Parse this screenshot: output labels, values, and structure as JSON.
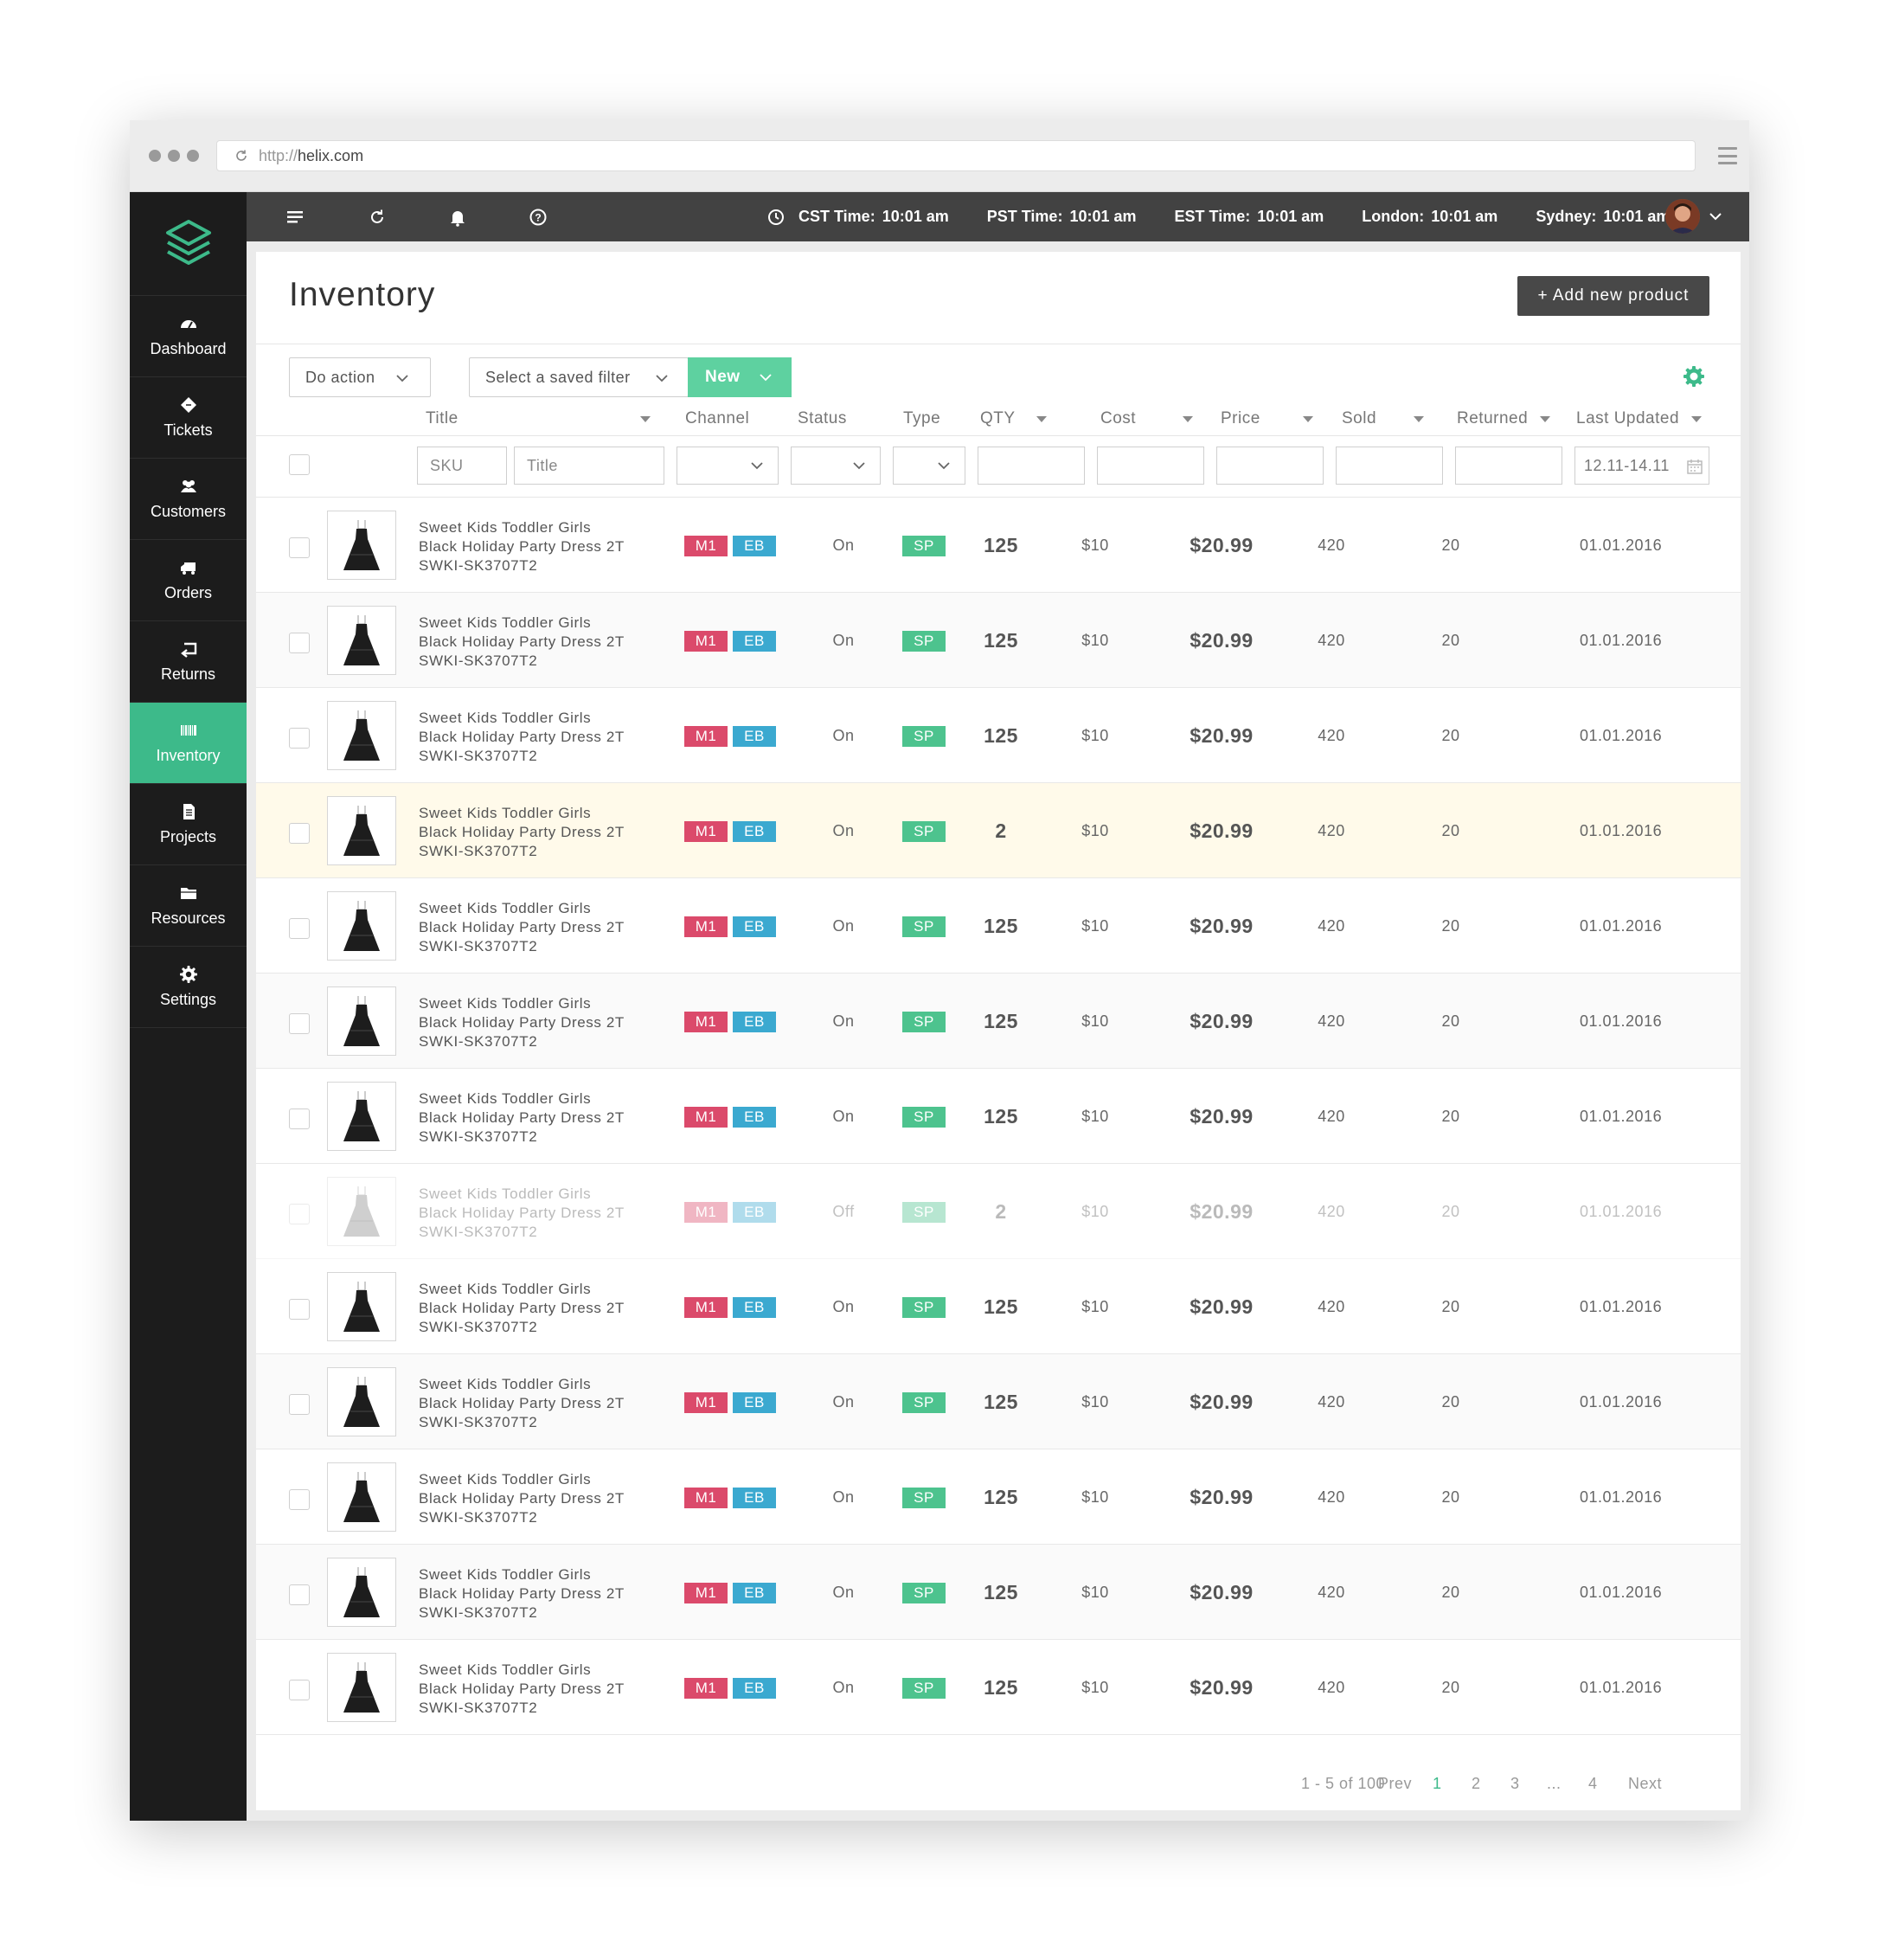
{
  "browser": {
    "url_proto": "http://",
    "url_host": "helix.com"
  },
  "topbar": {
    "times": [
      {
        "label": "CST Time:",
        "value": "10:01 am"
      },
      {
        "label": "PST Time:",
        "value": "10:01 am"
      },
      {
        "label": "EST Time:",
        "value": "10:01 am"
      },
      {
        "label": "London:",
        "value": "10:01 am"
      },
      {
        "label": "Sydney:",
        "value": "10:01 am"
      }
    ]
  },
  "sidebar": {
    "items": [
      {
        "label": "Dashboard",
        "icon": "dashboard-icon"
      },
      {
        "label": "Tickets",
        "icon": "ticket-icon"
      },
      {
        "label": "Customers",
        "icon": "customers-icon"
      },
      {
        "label": "Orders",
        "icon": "truck-icon"
      },
      {
        "label": "Returns",
        "icon": "return-icon"
      },
      {
        "label": "Inventory",
        "icon": "barcode-icon"
      },
      {
        "label": "Projects",
        "icon": "document-icon"
      },
      {
        "label": "Resources",
        "icon": "folder-icon"
      },
      {
        "label": "Settings",
        "icon": "gear-icon"
      }
    ],
    "active": "Inventory"
  },
  "page": {
    "title": "Inventory",
    "add_button": "+ Add new product"
  },
  "toolbar": {
    "do_action": "Do action",
    "saved_filter": "Select a saved filter",
    "new_label": "New"
  },
  "columns": {
    "title": "Title",
    "channel": "Channel",
    "status": "Status",
    "type": "Type",
    "qty": "QTY",
    "cost": "Cost",
    "price": "Price",
    "sold": "Sold",
    "returned": "Returned",
    "last_updated": "Last Updated"
  },
  "filters": {
    "sku_placeholder": "SKU",
    "title_placeholder": "Title",
    "date_range": "12.11-14.11"
  },
  "rows": [
    {
      "title1": "Sweet Kids Toddler Girls",
      "title2": "Black Holiday Party Dress 2T",
      "sku": "SWKI-SK3707T2",
      "ch1": "M1",
      "ch2": "EB",
      "status": "On",
      "type": "SP",
      "qty": "125",
      "cost": "$10",
      "price": "$20.99",
      "sold": "420",
      "returned": "20",
      "updated": "01.01.2016",
      "state": "normal"
    },
    {
      "title1": "Sweet Kids Toddler Girls",
      "title2": "Black Holiday Party Dress 2T",
      "sku": "SWKI-SK3707T2",
      "ch1": "M1",
      "ch2": "EB",
      "status": "On",
      "type": "SP",
      "qty": "125",
      "cost": "$10",
      "price": "$20.99",
      "sold": "420",
      "returned": "20",
      "updated": "01.01.2016",
      "state": "alt"
    },
    {
      "title1": "Sweet Kids Toddler Girls",
      "title2": "Black Holiday Party Dress 2T",
      "sku": "SWKI-SK3707T2",
      "ch1": "M1",
      "ch2": "EB",
      "status": "On",
      "type": "SP",
      "qty": "125",
      "cost": "$10",
      "price": "$20.99",
      "sold": "420",
      "returned": "20",
      "updated": "01.01.2016",
      "state": "normal"
    },
    {
      "title1": "Sweet Kids Toddler Girls",
      "title2": "Black Holiday Party Dress 2T",
      "sku": "SWKI-SK3707T2",
      "ch1": "M1",
      "ch2": "EB",
      "status": "On",
      "type": "SP",
      "qty": "2",
      "cost": "$10",
      "price": "$20.99",
      "sold": "420",
      "returned": "20",
      "updated": "01.01.2016",
      "state": "highlight"
    },
    {
      "title1": "Sweet Kids Toddler Girls",
      "title2": "Black Holiday Party Dress 2T",
      "sku": "SWKI-SK3707T2",
      "ch1": "M1",
      "ch2": "EB",
      "status": "On",
      "type": "SP",
      "qty": "125",
      "cost": "$10",
      "price": "$20.99",
      "sold": "420",
      "returned": "20",
      "updated": "01.01.2016",
      "state": "normal"
    },
    {
      "title1": "Sweet Kids Toddler Girls",
      "title2": "Black Holiday Party Dress 2T",
      "sku": "SWKI-SK3707T2",
      "ch1": "M1",
      "ch2": "EB",
      "status": "On",
      "type": "SP",
      "qty": "125",
      "cost": "$10",
      "price": "$20.99",
      "sold": "420",
      "returned": "20",
      "updated": "01.01.2016",
      "state": "alt"
    },
    {
      "title1": "Sweet Kids Toddler Girls",
      "title2": "Black Holiday Party Dress 2T",
      "sku": "SWKI-SK3707T2",
      "ch1": "M1",
      "ch2": "EB",
      "status": "On",
      "type": "SP",
      "qty": "125",
      "cost": "$10",
      "price": "$20.99",
      "sold": "420",
      "returned": "20",
      "updated": "01.01.2016",
      "state": "normal"
    },
    {
      "title1": "Sweet Kids Toddler Girls",
      "title2": "Black Holiday Party Dress 2T",
      "sku": "SWKI-SK3707T2",
      "ch1": "M1",
      "ch2": "EB",
      "status": "Off",
      "type": "SP",
      "qty": "2",
      "cost": "$10",
      "price": "$20.99",
      "sold": "420",
      "returned": "20",
      "updated": "01.01.2016",
      "state": "off"
    },
    {
      "title1": "Sweet Kids Toddler Girls",
      "title2": "Black Holiday Party Dress 2T",
      "sku": "SWKI-SK3707T2",
      "ch1": "M1",
      "ch2": "EB",
      "status": "On",
      "type": "SP",
      "qty": "125",
      "cost": "$10",
      "price": "$20.99",
      "sold": "420",
      "returned": "20",
      "updated": "01.01.2016",
      "state": "normal"
    },
    {
      "title1": "Sweet Kids Toddler Girls",
      "title2": "Black Holiday Party Dress 2T",
      "sku": "SWKI-SK3707T2",
      "ch1": "M1",
      "ch2": "EB",
      "status": "On",
      "type": "SP",
      "qty": "125",
      "cost": "$10",
      "price": "$20.99",
      "sold": "420",
      "returned": "20",
      "updated": "01.01.2016",
      "state": "alt"
    },
    {
      "title1": "Sweet Kids Toddler Girls",
      "title2": "Black Holiday Party Dress 2T",
      "sku": "SWKI-SK3707T2",
      "ch1": "M1",
      "ch2": "EB",
      "status": "On",
      "type": "SP",
      "qty": "125",
      "cost": "$10",
      "price": "$20.99",
      "sold": "420",
      "returned": "20",
      "updated": "01.01.2016",
      "state": "normal"
    },
    {
      "title1": "Sweet Kids Toddler Girls",
      "title2": "Black Holiday Party Dress 2T",
      "sku": "SWKI-SK3707T2",
      "ch1": "M1",
      "ch2": "EB",
      "status": "On",
      "type": "SP",
      "qty": "125",
      "cost": "$10",
      "price": "$20.99",
      "sold": "420",
      "returned": "20",
      "updated": "01.01.2016",
      "state": "alt"
    },
    {
      "title1": "Sweet Kids Toddler Girls",
      "title2": "Black Holiday Party Dress 2T",
      "sku": "SWKI-SK3707T2",
      "ch1": "M1",
      "ch2": "EB",
      "status": "On",
      "type": "SP",
      "qty": "125",
      "cost": "$10",
      "price": "$20.99",
      "sold": "420",
      "returned": "20",
      "updated": "01.01.2016",
      "state": "normal"
    }
  ],
  "pagination": {
    "summary": "1 - 5 of 100",
    "prev": "Prev",
    "pages": [
      "1",
      "2",
      "3",
      "...",
      "4"
    ],
    "current": "1",
    "next": "Next"
  },
  "colors": {
    "accent": "#3dba8a",
    "m1": "#db4a6b",
    "eb": "#3ba9d0",
    "sp": "#4dc38e",
    "highlight_row": "#fffaea"
  }
}
